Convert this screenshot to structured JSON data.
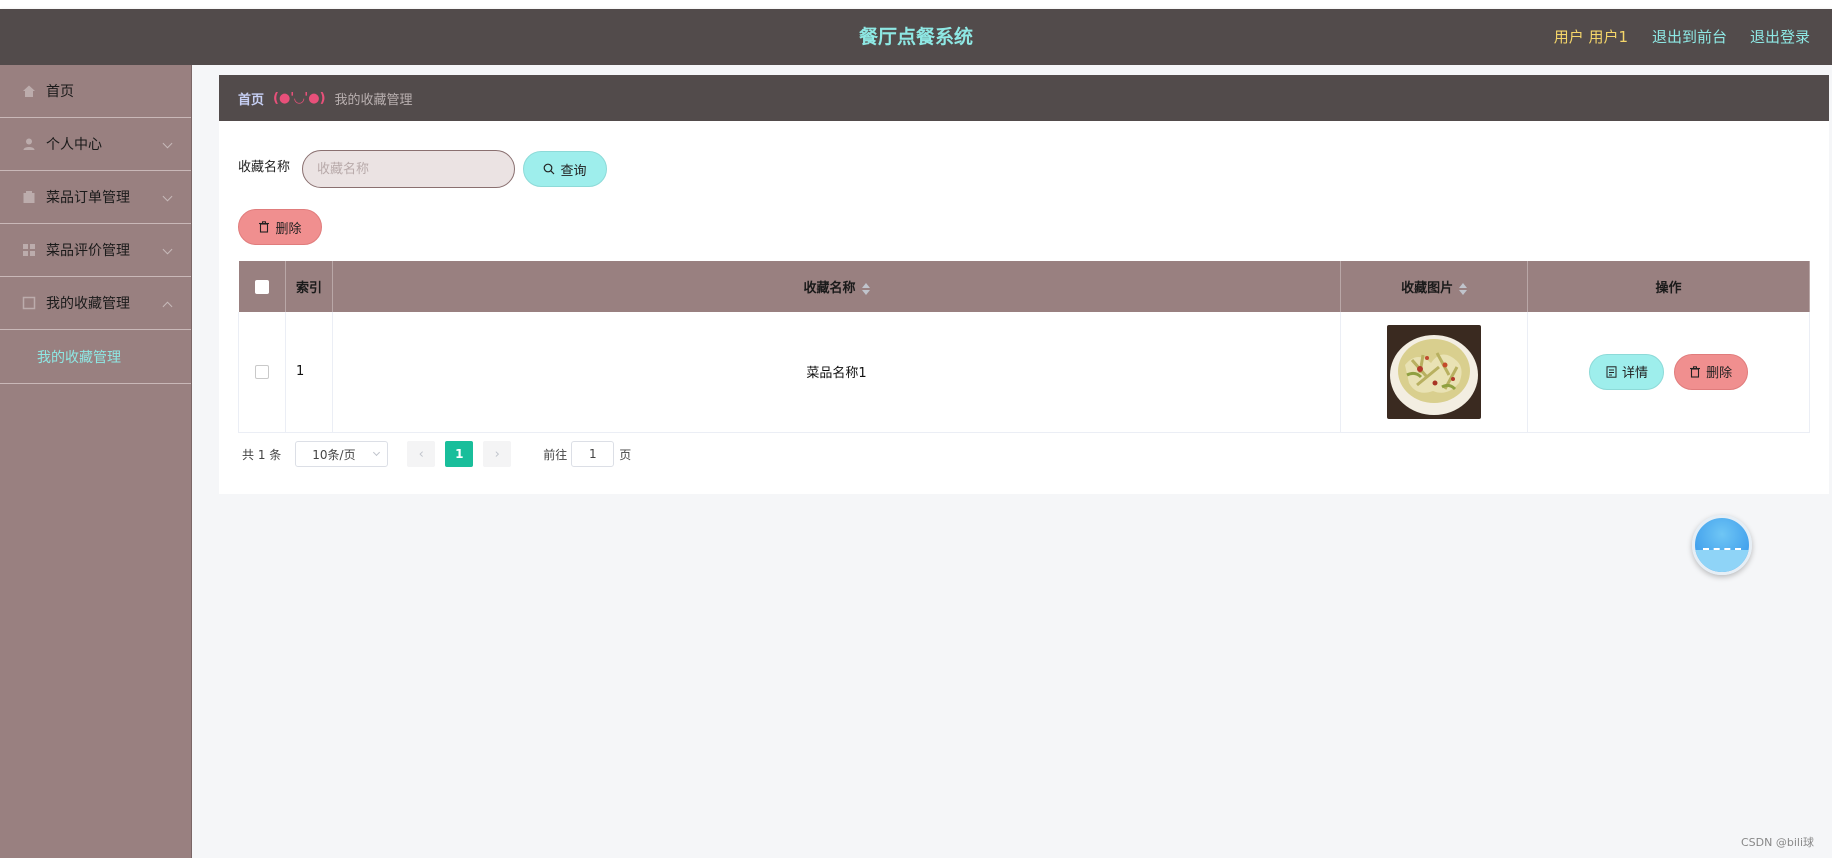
{
  "header": {
    "title": "餐厅点餐系统",
    "user_label": "用户 用户1",
    "front_link": "退出到前台",
    "logout_link": "退出登录"
  },
  "sidebar": {
    "items": [
      {
        "label": "首页",
        "icon": "home-icon"
      },
      {
        "label": "个人中心",
        "icon": "user-icon"
      },
      {
        "label": "菜品订单管理",
        "icon": "order-icon"
      },
      {
        "label": "菜品评价管理",
        "icon": "comment-icon"
      },
      {
        "label": "我的收藏管理",
        "icon": "favorite-icon"
      }
    ],
    "sub_items": [
      {
        "label": "我的收藏管理"
      }
    ]
  },
  "breadcrumb": {
    "home": "首页",
    "separator": "(●'◡'●)",
    "current": "我的收藏管理"
  },
  "search": {
    "label": "收藏名称",
    "placeholder": "收藏名称",
    "query_button": "查询",
    "delete_button": "删除"
  },
  "table": {
    "headers": {
      "index": "索引",
      "name": "收藏名称",
      "image": "收藏图片",
      "actions": "操作"
    },
    "rows": [
      {
        "index": "1",
        "name": "菜品名称1",
        "detail_button": "详情",
        "delete_button": "删除"
      }
    ]
  },
  "pagination": {
    "total": "共 1 条",
    "page_size": "10条/页",
    "current_page": "1",
    "goto_label": "前往",
    "goto_value": "1",
    "page_unit": "页"
  },
  "watermark": "CSDN @bili球",
  "colors": {
    "header_bg": "#524b4b",
    "title_color": "#8ee8e4",
    "sidebar_bg": "#998080",
    "primary_btn": "#9eeeec",
    "danger_btn": "#f08f8f",
    "page_active": "#19be9b"
  }
}
